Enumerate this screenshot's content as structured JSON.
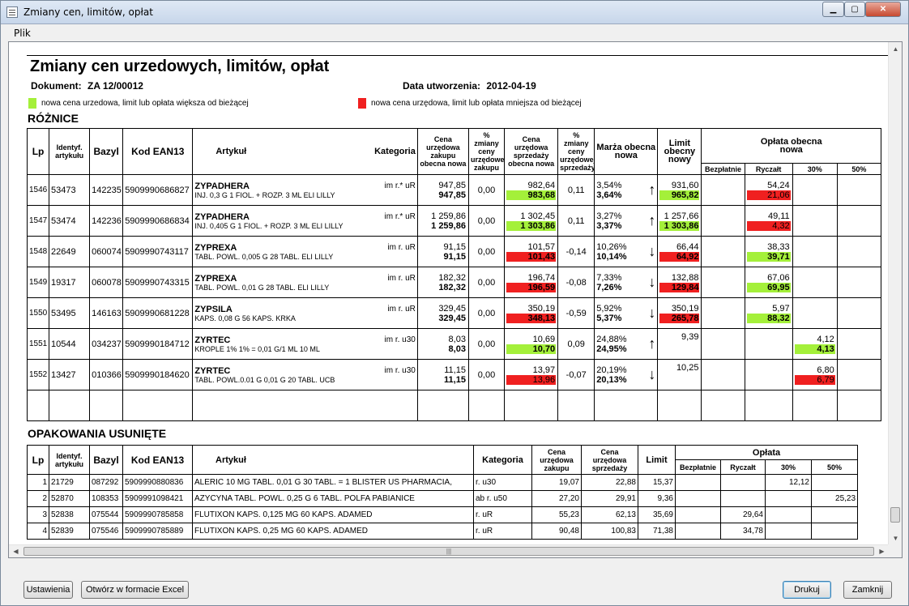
{
  "window": {
    "title": "Zmiany cen, limitów, opłat"
  },
  "menu": {
    "file": "Plik"
  },
  "report": {
    "title": "Zmiany cen urzedowych, limitów, opłat",
    "document_label": "Dokument:",
    "document_value": "ZA  12/00012",
    "created_label": "Data utworzenia:",
    "created_value": "2012-04-19",
    "legend_green": "nowa cena urzedowa, limit lub opłata większa od bieżącej",
    "legend_red": "nowa cena urzędowa, limit lub opłata mniejsza od bieżącej",
    "colors": {
      "green": "#a4f03a",
      "red": "#f02020"
    }
  },
  "diffs": {
    "heading": "RÓŻNICE",
    "headers": {
      "lp": "Lp",
      "id": "Identyf. artykułu",
      "bazyl": "Bazyl",
      "ean": "Kod EAN13",
      "artykul": "Artykuł",
      "kategoria": "Kategoria",
      "cena_zakupu": "Cena urzędowa zakupu obecna nowa",
      "zm_zakupu": "% zmiany ceny urzędowej zakupu",
      "cena_sprzedazy": "Cena urzędowa sprzedaży obecna nowa",
      "zm_sprzedazy": "% zmiany ceny urzędowej sprzedaży",
      "marza": "Marża obecna nowa",
      "limit": "Limit obecny nowy",
      "oplata": "Opłata obecna nowa",
      "bezplatnie": "Bezpłatnie",
      "ryczalt": "Ryczałt",
      "p30": "30%",
      "p50": "50%"
    },
    "rows": [
      {
        "lp": "1546",
        "id": "53473",
        "bazyl": "142235",
        "ean": "5909990686827",
        "name": "ZYPADHERA",
        "desc": "INJ.  0,3 G  1 FIOL. + ROZP. 3 ML  ELI LILLY",
        "cat": "im r.* uR",
        "zak_old": "947,85",
        "zak_new": "947,85",
        "zak_pct": "0,00",
        "spr_old": "982,64",
        "spr_new": "983,68",
        "spr_new_color": "green",
        "spr_pct": "0,11",
        "marza_old": "3,54%",
        "marza_new": "3,64%",
        "arrow": "↑",
        "lim_old": "931,60",
        "lim_new": "965,82",
        "lim_new_color": "green",
        "col": "ryczalt",
        "op_old": "54,24",
        "op_new": "21,06",
        "op_color": "red"
      },
      {
        "lp": "1547",
        "id": "53474",
        "bazyl": "142236",
        "ean": "5909990686834",
        "name": "ZYPADHERA",
        "desc": "INJ.  0,405 G  1 FIOL. + ROZP. 3 ML  ELI LILLY",
        "cat": "im r.* uR",
        "zak_old": "1 259,86",
        "zak_new": "1 259,86",
        "zak_pct": "0,00",
        "spr_old": "1 302,45",
        "spr_new": "1 303,86",
        "spr_new_color": "green",
        "spr_pct": "0,11",
        "marza_old": "3,27%",
        "marza_new": "3,37%",
        "arrow": "↑",
        "lim_old": "1 257,66",
        "lim_new": "1 303,86",
        "lim_new_color": "green",
        "col": "ryczalt",
        "op_old": "49,11",
        "op_new": "4,32",
        "op_color": "red"
      },
      {
        "lp": "1548",
        "id": "22649",
        "bazyl": "060074",
        "ean": "5909990743117",
        "name": "ZYPREXA",
        "desc": "TABL. POWL.  0,005 G  28 TABL.  ELI LILLY",
        "cat": "im r. uR",
        "zak_old": "91,15",
        "zak_new": "91,15",
        "zak_pct": "0,00",
        "spr_old": "101,57",
        "spr_new": "101,43",
        "spr_new_color": "red",
        "spr_pct": "-0,14",
        "marza_old": "10,26%",
        "marza_new": "10,14%",
        "arrow": "↓",
        "lim_old": "66,44",
        "lim_new": "64,92",
        "lim_new_color": "red",
        "col": "ryczalt",
        "op_old": "38,33",
        "op_new": "39,71",
        "op_color": "green"
      },
      {
        "lp": "1549",
        "id": "19317",
        "bazyl": "060078",
        "ean": "5909990743315",
        "name": "ZYPREXA",
        "desc": "TABL. POWL.  0,01 G  28 TABL.  ELI LILLY",
        "cat": "im r. uR",
        "zak_old": "182,32",
        "zak_new": "182,32",
        "zak_pct": "0,00",
        "spr_old": "196,74",
        "spr_new": "196,59",
        "spr_new_color": "red",
        "spr_pct": "-0,08",
        "marza_old": "7,33%",
        "marza_new": "7,26%",
        "arrow": "↓",
        "lim_old": "132,88",
        "lim_new": "129,84",
        "lim_new_color": "red",
        "col": "ryczalt",
        "op_old": "67,06",
        "op_new": "69,95",
        "op_color": "green"
      },
      {
        "lp": "1550",
        "id": "53495",
        "bazyl": "146163",
        "ean": "5909990681228",
        "name": "ZYPSILA",
        "desc": "KAPS.  0,08 G  56 KAPS.  KRKA",
        "cat": "im r. uR",
        "zak_old": "329,45",
        "zak_new": "329,45",
        "zak_pct": "0,00",
        "spr_old": "350,19",
        "spr_new": "348,13",
        "spr_new_color": "red",
        "spr_pct": "-0,59",
        "marza_old": "5,92%",
        "marza_new": "5,37%",
        "arrow": "↓",
        "lim_old": "350,19",
        "lim_new": "265,78",
        "lim_new_color": "red",
        "col": "ryczalt",
        "op_old": "5,97",
        "op_new": "88,32",
        "op_color": "green"
      },
      {
        "lp": "1551",
        "id": "10544",
        "bazyl": "034237",
        "ean": "5909990184712",
        "name": "ZYRTEC",
        "desc": "KROPLE 1%  1% = 0,01 G/1 ML  10 ML",
        "cat": "im r. u30",
        "zak_old": "8,03",
        "zak_new": "8,03",
        "zak_pct": "0,00",
        "spr_old": "10,69",
        "spr_new": "10,70",
        "spr_new_color": "green",
        "spr_pct": "0,09",
        "marza_old": "24,88%",
        "marza_new": "24,95%",
        "arrow": "↑",
        "lim_old": "9,39",
        "lim_new": "",
        "lim_new_color": "",
        "col": "p30",
        "op_old": "4,12",
        "op_new": "4,13",
        "op_color": "green"
      },
      {
        "lp": "1552",
        "id": "13427",
        "bazyl": "010366",
        "ean": "5909990184620",
        "name": "ZYRTEC",
        "desc": "TABL. POWL.0.01 G  0,01 G  20 TABL.  UCB",
        "cat": "im r. u30",
        "zak_old": "11,15",
        "zak_new": "11,15",
        "zak_pct": "0,00",
        "spr_old": "13,97",
        "spr_new": "13,96",
        "spr_new_color": "red",
        "spr_pct": "-0,07",
        "marza_old": "20,19%",
        "marza_new": "20,13%",
        "arrow": "↓",
        "lim_old": "10,25",
        "lim_new": "",
        "lim_new_color": "",
        "col": "p30",
        "op_old": "6,80",
        "op_new": "6,79",
        "op_color": "red"
      }
    ]
  },
  "removed": {
    "heading": "OPAKOWANIA USUNIĘTE",
    "headers": {
      "lp": "Lp",
      "id": "Identyf. artykułu",
      "bazyl": "Bazyl",
      "ean": "Kod EAN13",
      "artykul": "Artykuł",
      "kategoria": "Kategoria",
      "cena_zakupu": "Cena urzędowa zakupu",
      "cena_sprzedazy": "Cena urzędowa sprzedaży",
      "limit": "Limit",
      "oplata": "Opłata",
      "bezplatnie": "Bezpłatnie",
      "ryczalt": "Ryczałt",
      "p30": "30%",
      "p50": "50%"
    },
    "rows": [
      {
        "lp": "1",
        "id": "21729",
        "bazyl": "087292",
        "ean": "5909990880836",
        "art": "ALERIC  10 MG TABL.  0,01 G  30 TABL. = 1 BLISTER  US PHARMACIA,",
        "cat": "r. u30",
        "zak": "19,07",
        "spr": "22,88",
        "lim": "15,37",
        "bez": "",
        "ryc": "",
        "p30": "12,12",
        "p50": ""
      },
      {
        "lp": "2",
        "id": "52870",
        "bazyl": "108353",
        "ean": "5909991098421",
        "art": "AZYCYNA  TABL. POWL.  0,25 G  6 TABL.  POLFA PABIANICE",
        "cat": "ab r. u50",
        "zak": "27,20",
        "spr": "29,91",
        "lim": "9,36",
        "bez": "",
        "ryc": "",
        "p30": "",
        "p50": "25,23"
      },
      {
        "lp": "3",
        "id": "52838",
        "bazyl": "075544",
        "ean": "5909990785858",
        "art": "FLUTIXON  KAPS.  0,125 MG  60 KAPS.  ADAMED",
        "cat": "r. uR",
        "zak": "55,23",
        "spr": "62,13",
        "lim": "35,69",
        "bez": "",
        "ryc": "29,64",
        "p30": "",
        "p50": ""
      },
      {
        "lp": "4",
        "id": "52839",
        "bazyl": "075546",
        "ean": "5909990785889",
        "art": "FLUTIXON  KAPS.  0,25 MG  60 KAPS.  ADAMED",
        "cat": "r. uR",
        "zak": "90,48",
        "spr": "100,83",
        "lim": "71,38",
        "bez": "",
        "ryc": "34,78",
        "p30": "",
        "p50": ""
      }
    ]
  },
  "buttons": {
    "settings": "Ustawienia",
    "excel": "Otwórz w formacie Excel",
    "print": "Drukuj",
    "close": "Zamknij"
  }
}
